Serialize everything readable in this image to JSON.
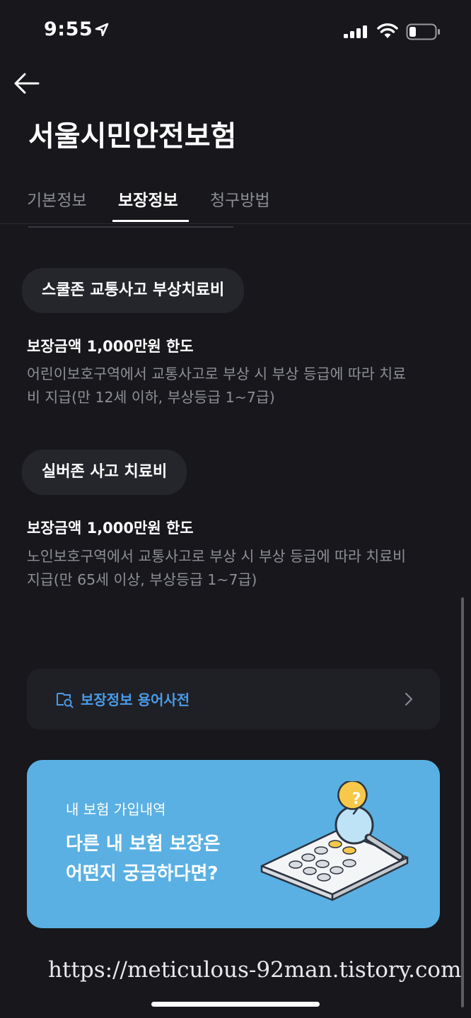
{
  "status_bar": {
    "time": "9:55"
  },
  "header": {
    "title": "서울시민안전보험"
  },
  "tabs": [
    {
      "label": "기본정보",
      "active": false
    },
    {
      "label": "보장정보",
      "active": true
    },
    {
      "label": "청구방법",
      "active": false
    }
  ],
  "coverages": [
    {
      "name": "스쿨존 교통사고 부상치료비",
      "amount": "보장금액 1,000만원 한도",
      "desc_line1": "어린이보호구역에서 교통사고로 부상 시 부상 등급에 따라 치료",
      "desc_line2": "비 지급(만 12세 이하, 부상등급 1~7급)"
    },
    {
      "name": "실버존 사고 치료비",
      "amount": "보장금액 1,000만원 한도",
      "desc_line1": "노인보호구역에서 교통사고로 부상 시 부상 등급에 따라 치료비",
      "desc_line2": "지급(만 65세 이상, 부상등급 1~7급)"
    }
  ],
  "glossary": {
    "label": "보장정보 용어사전"
  },
  "banner": {
    "small": "내 보험 가입내역",
    "line1": "다른 내 보험 보장은",
    "line2": "어떤지 궁금하다면?"
  },
  "watermark": "https://meticulous-92man.tistory.com",
  "colors": {
    "background": "#17171c",
    "accent": "#4a9be8",
    "banner": "#5ab0e3",
    "chip": "#25262c"
  },
  "icons": [
    "location-arrow-icon",
    "signal-icon",
    "wifi-icon",
    "battery-icon",
    "back-arrow-icon",
    "glossary-search-icon",
    "chevron-right-icon",
    "calculator-illustration"
  ]
}
